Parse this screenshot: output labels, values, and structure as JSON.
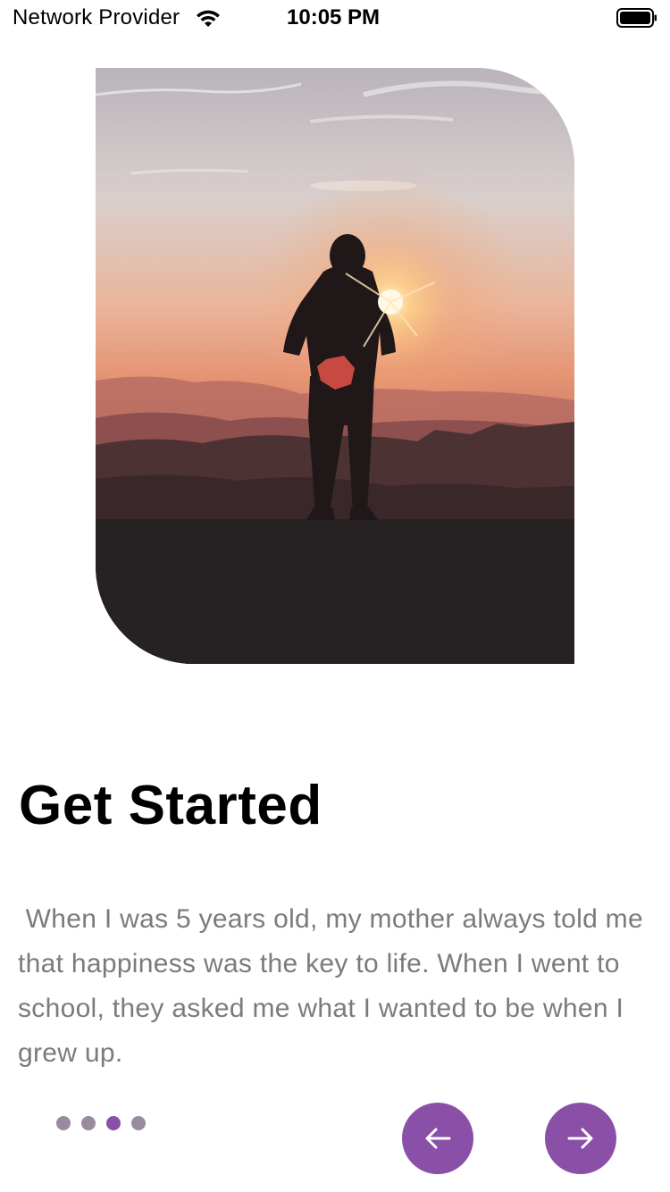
{
  "status_bar": {
    "carrier": "Network Provider",
    "time": "10:05 PM",
    "wifi_icon": "wifi-icon",
    "battery_icon": "battery-icon"
  },
  "hero": {
    "image": "silhouette-sunset-photo"
  },
  "content": {
    "title": "Get Started",
    "body": " When I was 5 years old, my mother always told me that happiness was the key to life. When I went to school, they asked me what I wanted to be when I grew up."
  },
  "pager": {
    "total": 4,
    "active_index": 2
  },
  "navigation": {
    "prev_icon": "arrow-left-icon",
    "next_icon": "arrow-right-icon"
  },
  "colors": {
    "accent": "#8a50a8",
    "dot_inactive": "#9a8aa0",
    "text_muted": "#7b7b7b"
  }
}
